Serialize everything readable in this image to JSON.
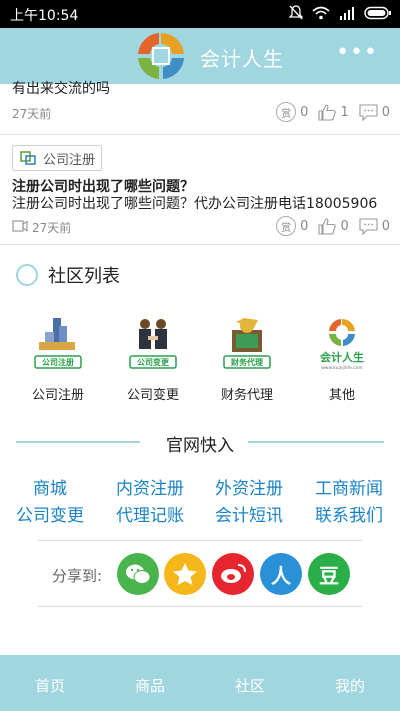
{
  "status_bar": {
    "time": "上午10:54"
  },
  "app_bar": {
    "title": "会计人生",
    "more": "•••"
  },
  "posts": [
    {
      "title_partial": "有出来交流的吗",
      "time": "27天前",
      "reward": "0",
      "likes": "1",
      "comments": "0"
    },
    {
      "tag": "公司注册",
      "title": "注册公司时出现了哪些问题？",
      "excerpt": "注册公司时出现了哪些问题？代办公司注册电话18005906",
      "time": "27天前",
      "reward": "0",
      "likes": "0",
      "comments": "0"
    }
  ],
  "reward_badge": "赏",
  "community": {
    "heading": "社区列表",
    "categories": [
      {
        "name": "公司注册",
        "badge": "公司注册"
      },
      {
        "name": "公司变更",
        "badge": "公司变更"
      },
      {
        "name": "财务代理",
        "badge": "财务代理"
      },
      {
        "name": "其他",
        "badge": "会计人生",
        "sub": "www.kuaijilife.com"
      }
    ]
  },
  "official": {
    "heading": "官网快入",
    "links": [
      "商城",
      "内资注册",
      "外资注册",
      "工商新闻",
      "公司变更",
      "代理记账",
      "会计短讯",
      "联系我们"
    ]
  },
  "share": {
    "label": "分享到:",
    "buttons": [
      {
        "name": "wechat",
        "glyph": "●",
        "color": "#49b44b"
      },
      {
        "name": "qzone",
        "glyph": "★",
        "color": "#f5b719"
      },
      {
        "name": "weibo",
        "glyph": "◉",
        "color": "#e6262e"
      },
      {
        "name": "renren",
        "glyph": "人",
        "color": "#2a90d8"
      },
      {
        "name": "douban",
        "glyph": "豆",
        "color": "#2aae48"
      }
    ]
  },
  "tabs": [
    "首页",
    "商品",
    "社区",
    "我的"
  ],
  "colors": {
    "accent": "#9fd6df",
    "link": "#1a83c6"
  }
}
